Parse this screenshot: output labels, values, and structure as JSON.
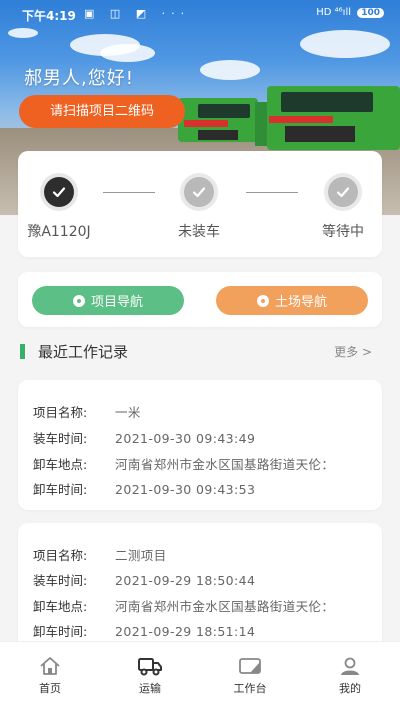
{
  "status_bar": {
    "time": "下午4:19",
    "left_icons": "▣ ◫ ◩ ···",
    "right_icons": "HD ⁴⁶ıll",
    "battery": "100"
  },
  "header": {
    "greeting": "郝男人,您好!",
    "scan_button": "请扫描项目二维码"
  },
  "progress": {
    "steps": [
      {
        "label": "豫A1120J",
        "state": "done"
      },
      {
        "label": "未装车",
        "state": "todo"
      },
      {
        "label": "等待中",
        "state": "todo"
      }
    ]
  },
  "navigation": {
    "project_nav": "项目导航",
    "site_nav": "土场导航"
  },
  "recent": {
    "title": "最近工作记录",
    "more": "更多 >"
  },
  "records": [
    {
      "labels": [
        "项目名称:",
        "装车时间:",
        "卸车地点:",
        "卸车时间:"
      ],
      "project": "一米",
      "load_time": "2021-09-30 09:43:49",
      "unload_place": "河南省郑州市金水区国基路街道天伦：",
      "unload_time": "2021-09-30 09:43:53"
    },
    {
      "labels": [
        "项目名称:",
        "装车时间:",
        "卸车地点:",
        "卸车时间:"
      ],
      "project": "二测项目",
      "load_time": "2021-09-29 18:50:44",
      "unload_place": "河南省郑州市金水区国基路街道天伦：",
      "unload_time": "2021-09-29 18:51:14"
    }
  ],
  "tabs": [
    {
      "label": "首页",
      "icon": "home-icon"
    },
    {
      "label": "运输",
      "icon": "truck-icon"
    },
    {
      "label": "工作台",
      "icon": "workbench-icon"
    },
    {
      "label": "我的",
      "icon": "user-icon"
    }
  ],
  "colors": {
    "accent_orange": "#ee6121",
    "green_button": "#5cbf85",
    "orange_button": "#f2a15d",
    "section_bar": "#38b06c"
  }
}
